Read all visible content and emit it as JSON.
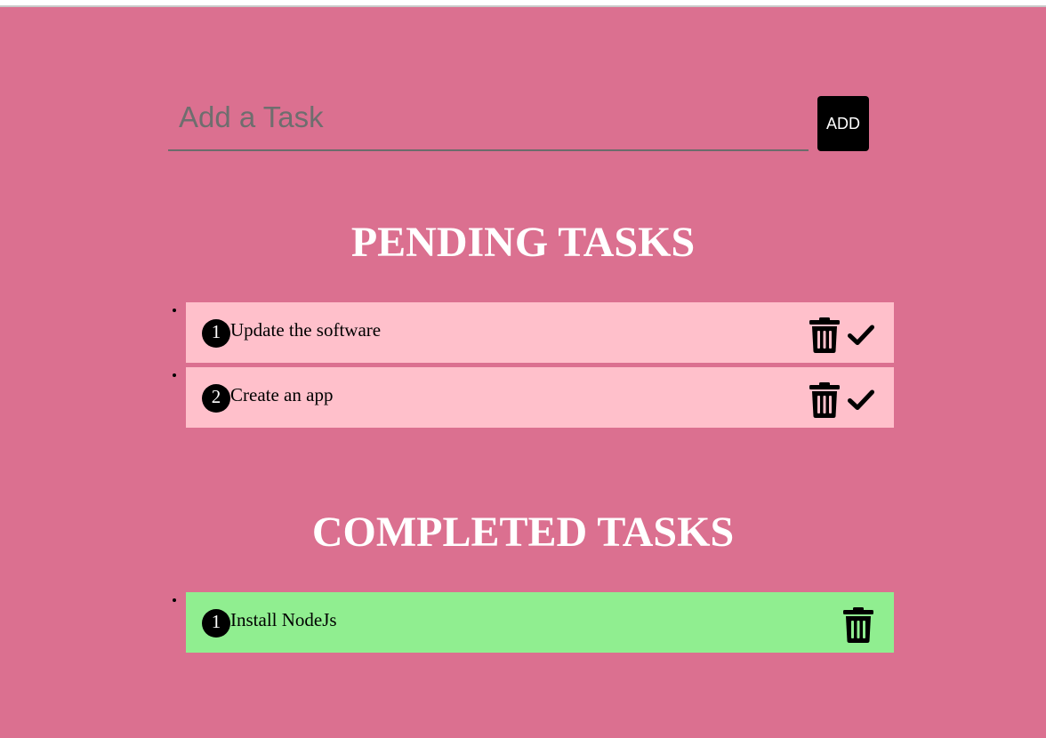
{
  "input": {
    "placeholder": "Add a Task",
    "value": ""
  },
  "add_button": {
    "label": "ADD"
  },
  "pending": {
    "title": "PENDING TASKS",
    "tasks": [
      {
        "number": "1",
        "text": "Update the software"
      },
      {
        "number": "2",
        "text": "Create an app"
      }
    ]
  },
  "completed": {
    "title": "COMPLETED TASKS",
    "tasks": [
      {
        "number": "1",
        "text": "Install NodeJs"
      }
    ]
  },
  "icons": {
    "delete": "trash-icon",
    "complete": "check-icon"
  },
  "colors": {
    "background": "#db7090",
    "pending_item": "#ffc0cb",
    "completed_item": "#90ee90",
    "button": "#000000",
    "title": "#ffffff"
  }
}
